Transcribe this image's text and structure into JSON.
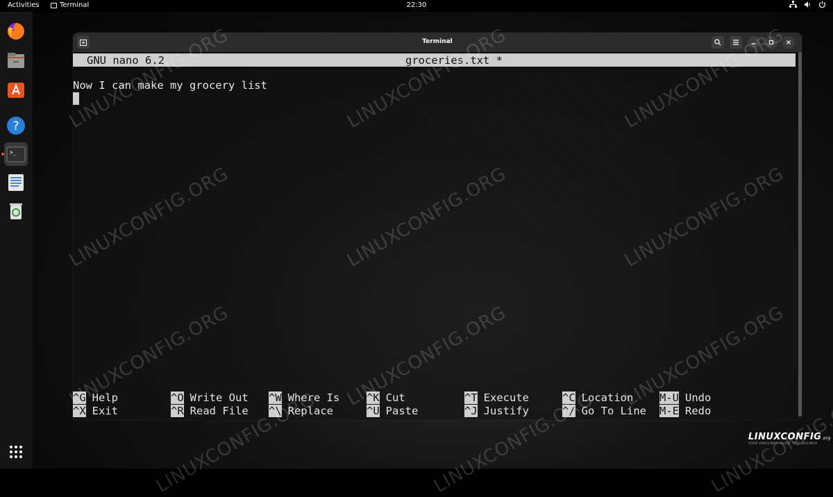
{
  "topbar": {
    "activities": "Activities",
    "app_name": "Terminal",
    "clock": "22:30"
  },
  "dock": {
    "items": [
      {
        "name": "firefox",
        "icon": "firefox-icon"
      },
      {
        "name": "files",
        "icon": "files-icon"
      },
      {
        "name": "software",
        "icon": "software-store-icon"
      },
      {
        "name": "help",
        "icon": "help-icon"
      },
      {
        "name": "terminal",
        "icon": "terminal-icon",
        "active": true
      },
      {
        "name": "text-editor",
        "icon": "text-editor-icon"
      },
      {
        "name": "trash",
        "icon": "trash-icon"
      }
    ],
    "help_glyph": "?",
    "terminal_glyph": ">_"
  },
  "window": {
    "title": "Terminal"
  },
  "nano": {
    "version": "GNU nano 6.2",
    "filename": "groceries.txt *",
    "lines": [
      "Now I can make my grocery list"
    ],
    "shortcuts_row1": [
      {
        "key": "^G",
        "label": "Help"
      },
      {
        "key": "^O",
        "label": "Write Out"
      },
      {
        "key": "^W",
        "label": "Where Is"
      },
      {
        "key": "^K",
        "label": "Cut"
      },
      {
        "key": "^T",
        "label": "Execute"
      },
      {
        "key": "^C",
        "label": "Location"
      },
      {
        "key": "M-U",
        "label": "Undo"
      }
    ],
    "shortcuts_row2": [
      {
        "key": "^X",
        "label": "Exit"
      },
      {
        "key": "^R",
        "label": "Read File"
      },
      {
        "key": "^\\",
        "label": "Replace"
      },
      {
        "key": "^U",
        "label": "Paste"
      },
      {
        "key": "^J",
        "label": "Justify"
      },
      {
        "key": "^/",
        "label": "Go To Line"
      },
      {
        "key": "M-E",
        "label": "Redo"
      }
    ]
  },
  "watermark": "LINUXCONFIG.ORG",
  "logo": {
    "brand": "LINUXCONFIG",
    "suffix": ".org",
    "tagline": "YOUR GNU/LINUX GUIDE TO GNU/LINUX"
  },
  "colors": {
    "accent": "#e95420",
    "nano_bar": "#cfcfcf",
    "titlebar": "#2c2c2c"
  }
}
